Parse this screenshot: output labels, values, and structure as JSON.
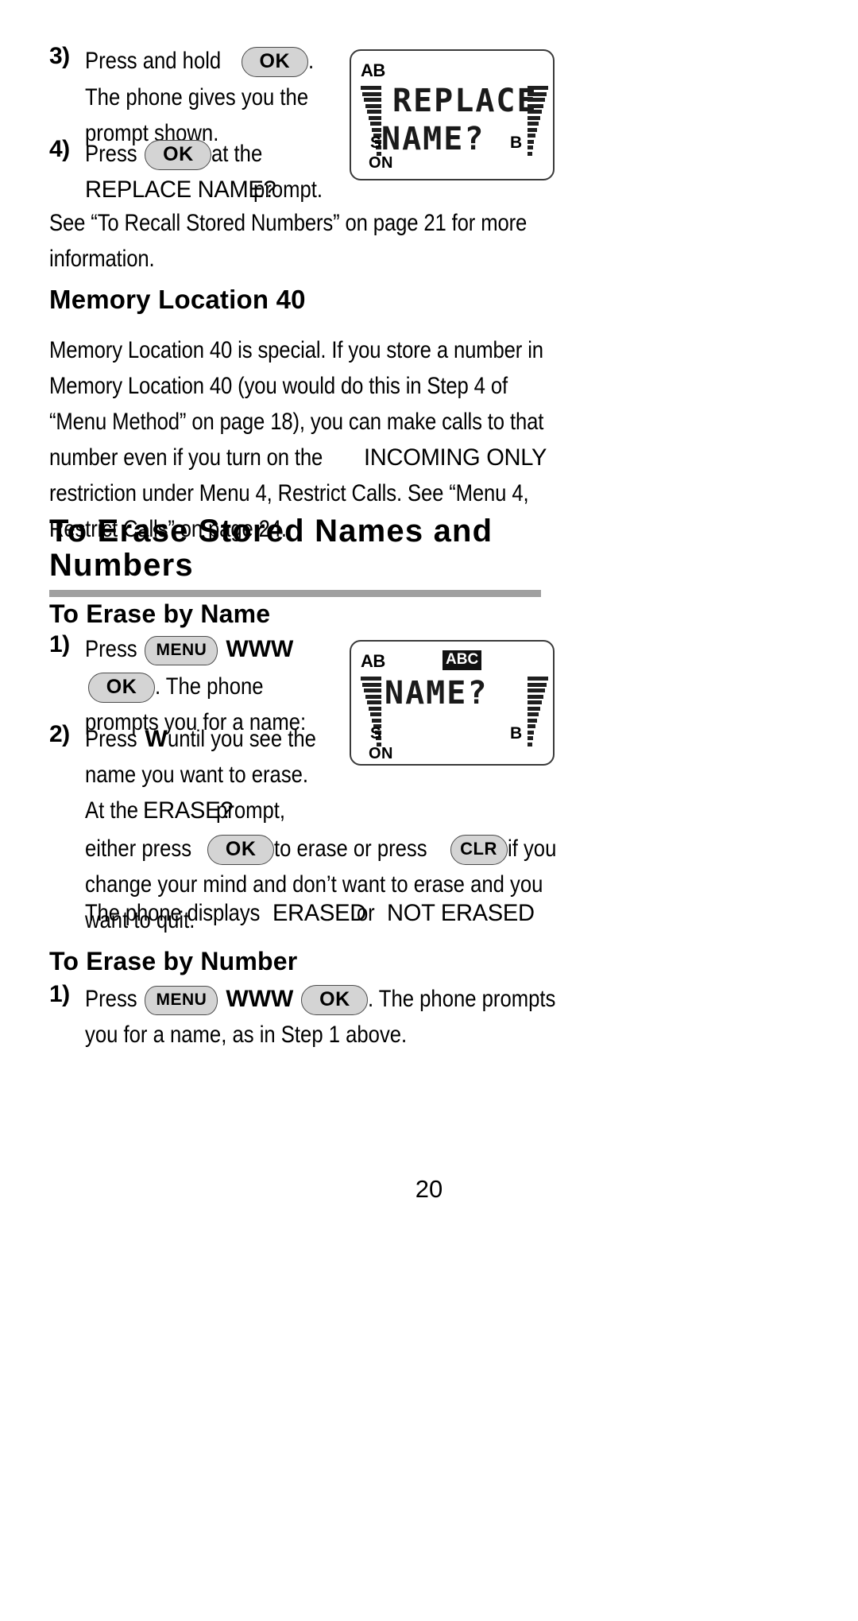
{
  "page": {
    "number": "20"
  },
  "steps_top": [
    {
      "num": "3)",
      "lines": [
        {
          "pre": "Press and hold ",
          "key": "OK",
          "post": " ."
        },
        {
          "pre": "The phone gives you the",
          "key": null,
          "post": ""
        },
        {
          "pre": "prompt shown.",
          "key": null,
          "post": ""
        }
      ]
    },
    {
      "num": "4)",
      "lines": [
        {
          "pre": "Press ",
          "key": "OK",
          "post": " at the"
        },
        {
          "pre": "",
          "key": null,
          "post": ""
        }
      ],
      "prompt_line": {
        "prompt": "REPLACE NAME?",
        "tail": "prompt."
      }
    }
  ],
  "see_also": {
    "line1": "See “To Recall Stored Numbers” on page 21 for more",
    "line2": "information."
  },
  "memory_section": {
    "heading": "Memory Location 40",
    "lines": [
      "Memory Location 40 is special. If you store a number in",
      "Memory Location 40 (you would do this in Step 4 of",
      "“Menu Method” on page 18), you can make calls to that",
      "number even if you turn on the ",
      "restriction under Menu 4, Restrict Calls. See “Menu 4,",
      "Restrict Calls” on page 24."
    ],
    "inline_prompt": "INCOMING ONLY"
  },
  "main_heading": {
    "line1": "To Erase Stored Names and",
    "line2": "Numbers",
    "rule_color": "#a0a0a0"
  },
  "erase_by_name": {
    "heading": "To Erase by Name",
    "step1": {
      "num": "1)",
      "l1_pre": "Press ",
      "l1_key": "MENU",
      "l1_nav": "WWW",
      "l2_key": "OK",
      "l2_post": ". The phone",
      "l3": "prompts you for a name:"
    },
    "step2": {
      "num": "2)",
      "l1_pre": "Press ",
      "l1_nav": "W",
      "l1_post": " until you see the",
      "l2": "name you want to erase.",
      "l3_pre": "At the ",
      "l3_prompt": "ERASE?",
      "l3_post": "prompt,",
      "l4_pre": "either press ",
      "l4_key1": "OK",
      "l4_mid": " to erase or press ",
      "l4_key2": "CLR",
      "l4_post": " if you",
      "l5": "change your mind and don’t want to erase and you",
      "l6": "want to quit."
    },
    "result": {
      "pre": "The phone displays ",
      "word1": "ERASED",
      "mid": "or ",
      "word2": "NOT ERASED"
    }
  },
  "erase_by_number": {
    "heading": "To Erase by Number",
    "step1": {
      "num": "1)",
      "l1_pre": "Press ",
      "l1_key1": "MENU",
      "l1_nav": "WWW",
      "l1_key2": "OK",
      "l1_post": ". The phone prompts",
      "l2": "you for a name, as in Step 1 above."
    }
  },
  "lcd_top": {
    "ab": "AB",
    "line1": "REPLACE",
    "line2": "NAME?",
    "s": "S",
    "b": "B",
    "on": "ON"
  },
  "lcd_mid": {
    "ab": "AB",
    "abc": "ABC",
    "line1": "NAME?",
    "s": "S",
    "b": "B",
    "on": "ON"
  }
}
